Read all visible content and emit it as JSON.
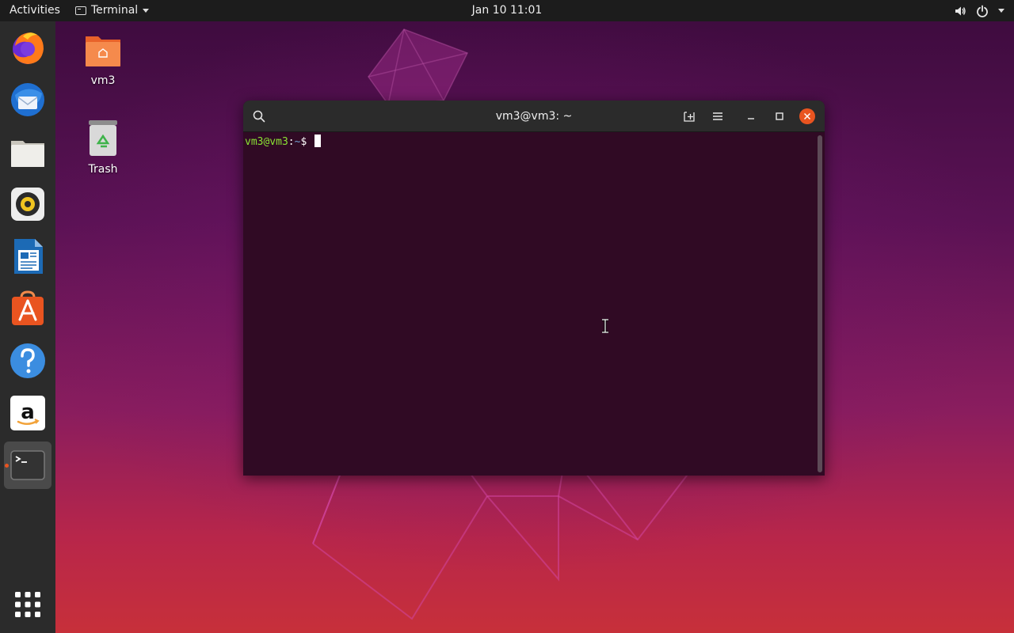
{
  "topbar": {
    "activities": "Activities",
    "app_name": "Terminal",
    "clock": "Jan 10  11:01",
    "icons": [
      "volume-icon",
      "power-icon",
      "system-menu-caret-icon"
    ]
  },
  "dock": {
    "apps": [
      {
        "name": "firefox",
        "icon": "firefox-icon"
      },
      {
        "name": "thunderbird",
        "icon": "thunderbird-icon"
      },
      {
        "name": "files",
        "icon": "files-icon"
      },
      {
        "name": "rhythmbox",
        "icon": "rhythmbox-icon"
      },
      {
        "name": "libreoffice-writer",
        "icon": "writer-icon"
      },
      {
        "name": "ubuntu-software",
        "icon": "software-center-icon"
      },
      {
        "name": "help",
        "icon": "help-icon"
      },
      {
        "name": "amazon",
        "icon": "amazon-icon"
      },
      {
        "name": "terminal",
        "icon": "terminal-icon",
        "running": true
      }
    ],
    "show_apps_icon": "show-applications-icon"
  },
  "desktop": {
    "home_label": "vm3",
    "trash_label": "Trash"
  },
  "terminal": {
    "title": "vm3@vm3: ~",
    "prompt_user": "vm3@vm3",
    "prompt_sep": ":",
    "prompt_path": "~",
    "prompt_symbol": "$ ",
    "header_icons": [
      "search-icon",
      "new-tab-icon",
      "hamburger-menu-icon",
      "minimize-icon",
      "maximize-icon",
      "close-icon"
    ]
  },
  "colors": {
    "terminal_bg": "#300a24",
    "prompt_user": "#8ae234",
    "prompt_path": "#729fcf",
    "close_button": "#e95420",
    "dock_bg": "#2b2b2b",
    "topbar_bg": "#1c1c1c"
  }
}
